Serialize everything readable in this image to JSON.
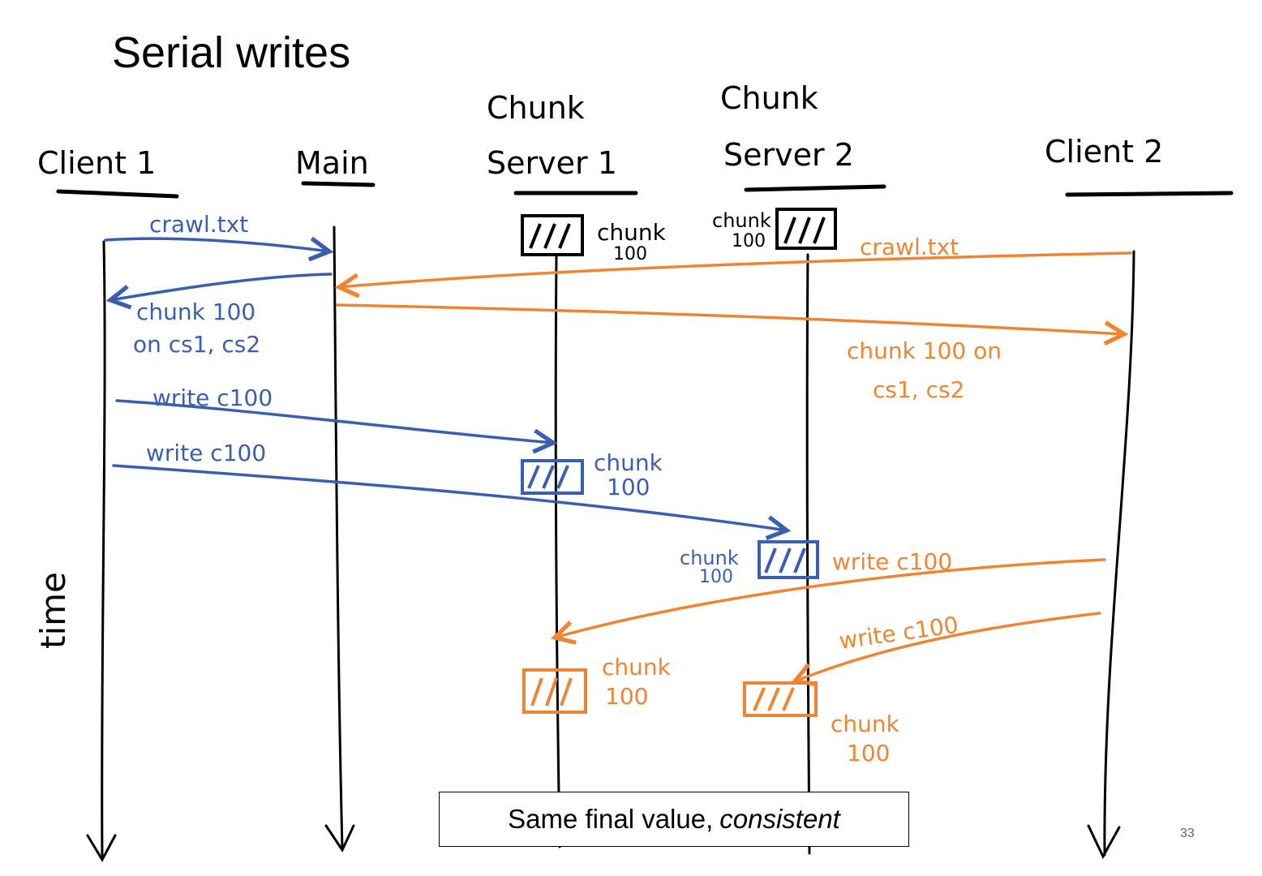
{
  "slide": {
    "title": "Serial writes",
    "caption_plain": "Same final value,",
    "caption_italic": "consistent",
    "page_number": "33"
  },
  "colors": {
    "ink": "#000000",
    "client1": "#3a5fb0",
    "client2": "#ee8533"
  },
  "participants": [
    {
      "id": "client1",
      "label_lines": [
        "Client 1"
      ]
    },
    {
      "id": "main",
      "label_lines": [
        "Main"
      ]
    },
    {
      "id": "cs1",
      "label_lines": [
        "Chunk",
        "Server 1"
      ]
    },
    {
      "id": "cs2",
      "label_lines": [
        "Chunk",
        "Server 2"
      ]
    },
    {
      "id": "client2",
      "label_lines": [
        "Client 2"
      ]
    }
  ],
  "axis_label": "time",
  "messages": [
    {
      "from": "client1",
      "to": "main",
      "label": "crawl.txt"
    },
    {
      "from": "main",
      "to": "client1",
      "label_lines": [
        "chunk 100",
        "on cs1, cs2"
      ]
    },
    {
      "from": "client2",
      "to": "main",
      "label": "crawl.txt"
    },
    {
      "from": "main",
      "to": "client2",
      "label_lines": [
        "chunk 100 on",
        "cs1, cs2"
      ]
    },
    {
      "from": "client1",
      "to": "cs1",
      "label": "write c100"
    },
    {
      "from": "client1",
      "to": "cs2",
      "label": "write c100"
    },
    {
      "from": "client2",
      "to": "cs1",
      "label": "write c100"
    },
    {
      "from": "client2",
      "to": "cs2",
      "label": "write c100"
    }
  ],
  "chunk_states": {
    "cs1_initial": [
      "chunk",
      "100"
    ],
    "cs2_initial": [
      "chunk",
      "100"
    ],
    "cs1_after_client1": [
      "chunk",
      "100"
    ],
    "cs2_after_client1": [
      "chunk",
      "100"
    ],
    "cs1_after_client2": [
      "chunk",
      "100"
    ],
    "cs2_after_client2": [
      "chunk",
      "100"
    ]
  }
}
